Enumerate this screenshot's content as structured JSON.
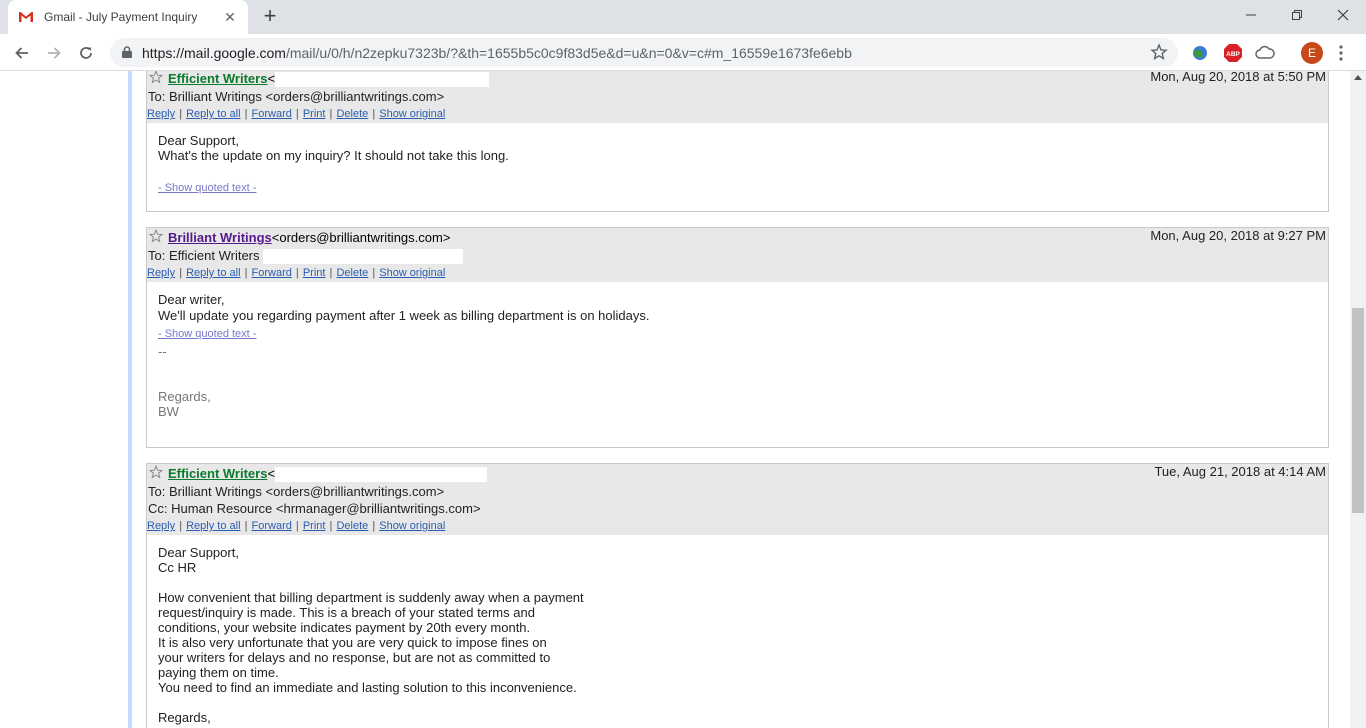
{
  "browser": {
    "tab_title": "Gmail - July Payment Inquiry",
    "url_host": "https://mail.google.com",
    "url_path": "/mail/u/0/h/n2zepku7323b/?&th=1655b5c0c9f83d5e&d=u&n=0&v=c#m_16559e1673fe6ebb",
    "profile_initial": "E",
    "colors": {
      "tabbar": "#dee1e6",
      "omnibox": "#f1f3f4",
      "profile": "#c5491a",
      "gmail_red": "#d93025"
    }
  },
  "messages": [
    {
      "sender": "Efficient Writers",
      "sender_suffix": "<",
      "date": "Mon, Aug 20, 2018 at 5:50 PM",
      "to": "To: Brilliant Writings <orders@brilliantwritings.com>",
      "body": [
        "Dear Support,",
        "What's the update on my inquiry? It should not take this long."
      ],
      "quoted": "- Show quoted text -"
    },
    {
      "sender": "Brilliant Writings",
      "sender_suffix": "<orders@brilliantwritings.com>",
      "date": "Mon, Aug 20, 2018 at 9:27 PM",
      "to": "To: Efficient Writers",
      "body": [
        "Dear writer,",
        "We'll update you regarding payment after 1 week as billing department is on holidays."
      ],
      "quoted": "- Show quoted text -",
      "signature": [
        "--",
        "",
        "",
        "Regards,",
        "BW"
      ]
    },
    {
      "sender": "Efficient Writers",
      "sender_suffix": "<",
      "date": "Tue, Aug 21, 2018 at 4:14 AM",
      "to": "To: Brilliant Writings <orders@brilliantwritings.com>",
      "cc": "Cc: Human Resource <hrmanager@brilliantwritings.com>",
      "body": [
        "Dear Support,",
        "Cc HR",
        "",
        "How convenient that billing department is suddenly away when a payment",
        "request/inquiry is made. This is a breach of your stated terms and",
        "conditions, your website indicates payment by 20th every month.",
        "It is also very unfortunate that you are very quick to impose fines on",
        "your writers for delays and no response, but are not as committed to",
        "paying them on time.",
        "You need to find an immediate and lasting solution to this inconvenience.",
        "",
        "Regards,"
      ]
    }
  ],
  "actions": {
    "reply": "Reply",
    "reply_all": "Reply to all",
    "forward": "Forward",
    "print": "Print",
    "delete": "Delete",
    "show_original": "Show original",
    "sep": "|"
  }
}
